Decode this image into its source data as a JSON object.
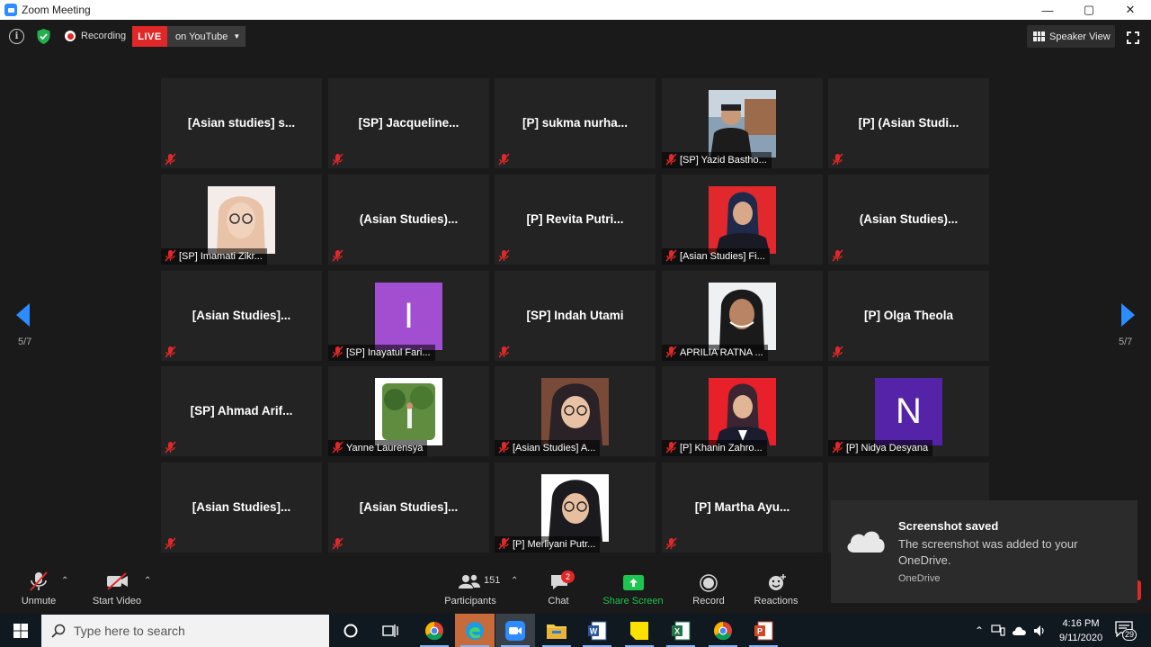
{
  "window": {
    "title": "Zoom Meeting",
    "minimize": "—",
    "maximize": "▢",
    "close": "✕"
  },
  "topbar": {
    "recording_label": "Recording",
    "live_label": "LIVE",
    "youtube_label": "on YouTube",
    "speaker_view_label": "Speaker View"
  },
  "pagination": {
    "left": "5/7",
    "right": "5/7"
  },
  "tiles": [
    {
      "center": "[Asian studies] s...",
      "label": ""
    },
    {
      "center": "[SP]  Jacqueline...",
      "label": ""
    },
    {
      "center": "[P] sukma nurha...",
      "label": ""
    },
    {
      "center": "",
      "label": "[SP] Yazid Bastho..."
    },
    {
      "center": "[P] (Asian Studi...",
      "label": ""
    },
    {
      "center": "",
      "label": "[SP] Imamati Zikr..."
    },
    {
      "center": "(Asian Studies)...",
      "label": ""
    },
    {
      "center": "[P]  Revita Putri...",
      "label": ""
    },
    {
      "center": "",
      "label": "[Asian Studies] Fi..."
    },
    {
      "center": "(Asian Studies)...",
      "label": ""
    },
    {
      "center": "[Asian Studies]...",
      "label": ""
    },
    {
      "center": "",
      "label": "[SP] Inayatul Fari...",
      "letter": "I"
    },
    {
      "center": "[SP] Indah Utami",
      "label": ""
    },
    {
      "center": "",
      "label": "APRILIA RATNA ..."
    },
    {
      "center": "[P] Olga Theola",
      "label": ""
    },
    {
      "center": "[SP]  Ahmad Arif...",
      "label": ""
    },
    {
      "center": "",
      "label": "Yanne Laurensya"
    },
    {
      "center": "",
      "label": "[Asian Studies] A..."
    },
    {
      "center": "",
      "label": "[P] Khanin Zahro..."
    },
    {
      "center": "",
      "label": "[P] Nidya Desyana",
      "letter": "N"
    },
    {
      "center": "[Asian Studies]...",
      "label": ""
    },
    {
      "center": "[Asian Studies]...",
      "label": ""
    },
    {
      "center": "",
      "label": "[P] Merliyani Putr..."
    },
    {
      "center": "[P]  Martha Ayu...",
      "label": ""
    }
  ],
  "toolbar": {
    "unmute": "Unmute",
    "start_video": "Start Video",
    "participants": "Participants",
    "participant_count": "151",
    "chat": "Chat",
    "chat_badge": "2",
    "share_screen": "Share Screen",
    "record": "Record",
    "reactions": "Reactions"
  },
  "toast": {
    "title": "Screenshot saved",
    "body": "The screenshot was added to your OneDrive.",
    "source": "OneDrive"
  },
  "taskbar": {
    "search_placeholder": "Type here to search",
    "time": "4:16 PM",
    "date": "9/11/2020",
    "notification_count": "29"
  },
  "colors": {
    "accent": "#2D8CFF",
    "live": "#E02828",
    "share": "#1DC44F",
    "tile": "#232323"
  }
}
